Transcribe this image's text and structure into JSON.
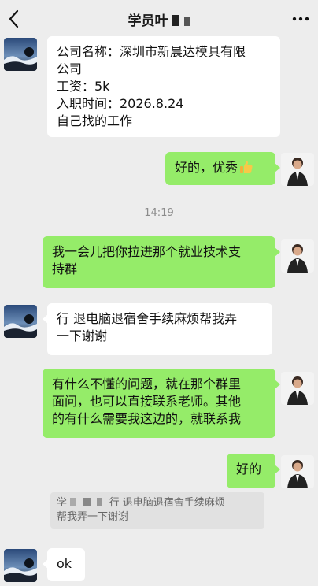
{
  "header": {
    "title": "学员叶"
  },
  "messages": [
    {
      "side": "left",
      "lines": [
        "公司名称：深圳市新晨达模具有限",
        "公司",
        "工资：5k",
        "入职时间：2026.8.24",
        "自己找的工作"
      ]
    },
    {
      "side": "right",
      "text": "好的，优秀"
    },
    {
      "side": "right",
      "lines": [
        "我一会儿把你拉进那个就业技术支",
        "持群"
      ]
    },
    {
      "side": "left",
      "lines": [
        "行 退电脑退宿舍手续麻烦帮我弄",
        "一下谢谢"
      ]
    },
    {
      "side": "right",
      "lines": [
        "有什么不懂的问题，就在那个群里",
        "面问，也可以直接联系老师。其他",
        "的有什么需要我这边的，就联系我"
      ]
    },
    {
      "side": "right",
      "text": "好的"
    },
    {
      "side": "left",
      "text": "ok"
    }
  ],
  "timestamp": "14:19",
  "quote": {
    "author": "学",
    "lines": [
      "行 退电脑退宿舍手续麻烦",
      "帮我弄一下谢谢"
    ]
  },
  "colors": {
    "background": "#ededed",
    "green_bubble": "#95ec69",
    "white_bubble": "#ffffff"
  },
  "icons": {
    "back": "chevron-left-icon",
    "more": "more-dots-icon",
    "emoji": "thumbs-up-icon"
  }
}
